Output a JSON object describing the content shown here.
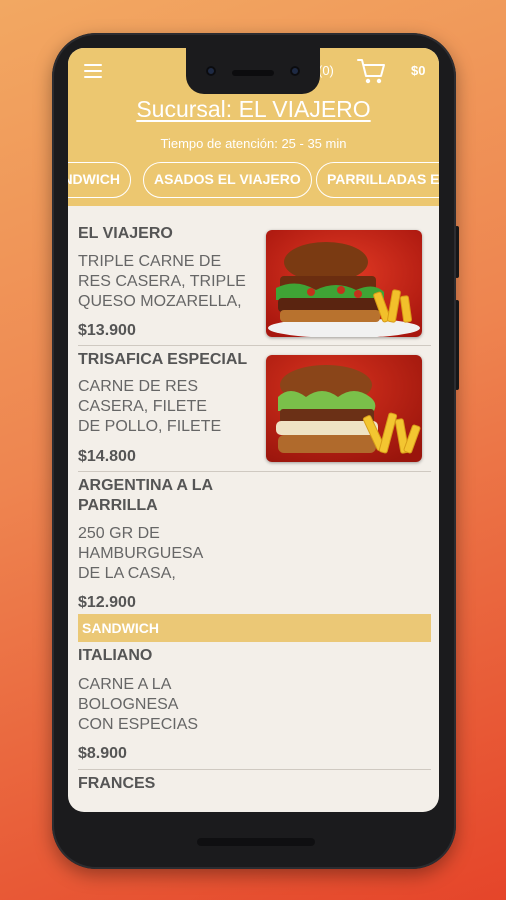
{
  "header": {
    "cart_count": "(0)",
    "cart_total": "$0",
    "branch_title": "Sucursal: EL VIAJERO",
    "wait_time": "Tiempo de atención: 25 - 35 min",
    "tabs": [
      {
        "label": "SANDWICH"
      },
      {
        "label": "ASADOS EL VIAJERO"
      },
      {
        "label": "PARRILLADAS EL VIAJERO"
      }
    ]
  },
  "products": [
    {
      "name": "EL VIAJERO",
      "desc_lines": [
        "TRIPLE CARNE DE",
        "RES CASERA, TRIPLE",
        "QUESO MOZARELLA,"
      ],
      "price": "$13.900"
    },
    {
      "name": "TRISAFICA ESPECIAL",
      "desc_lines": [
        "CARNE DE RES",
        "CASERA, FILETE",
        "DE POLLO, FILETE"
      ],
      "price": "$14.800"
    },
    {
      "name_lines": [
        "ARGENTINA A LA",
        "PARRILLA"
      ],
      "desc_lines": [
        "250 GR DE",
        "HAMBURGUESA",
        "DE LA CASA,"
      ],
      "price": "$12.900"
    }
  ],
  "section": {
    "label": "SANDWICH"
  },
  "sandwich_products": [
    {
      "name": "ITALIANO",
      "desc_lines": [
        "CARNE A LA",
        "BOLOGNESA",
        "CON ESPECIAS"
      ],
      "price": "$8.900"
    },
    {
      "name": "FRANCES"
    }
  ],
  "colors": {
    "header": "#ecc770",
    "section_bar": "#ebc876",
    "background": "#f3efe9"
  }
}
